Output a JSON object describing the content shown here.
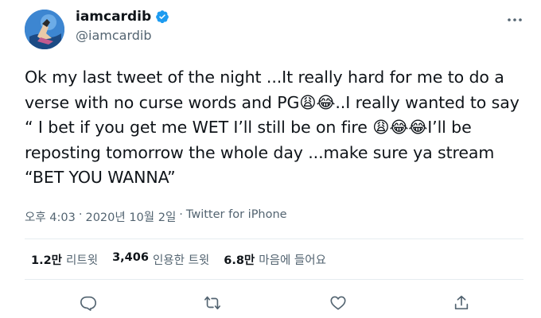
{
  "user": {
    "display_name": "iamcardib",
    "handle": "@iamcardib",
    "verified": true,
    "avatar_icon": "avatar-image"
  },
  "tweet": {
    "text": "Ok my last tweet of the night ...It really hard for me to do a verse with no curse words and PG😩😂..I really wanted to say “ I bet if you get me WET I’ll still be on fire 😩😂😂I’ll be reposting tomorrow the whole day ...make sure ya stream “BET YOU WANNA”"
  },
  "meta": {
    "time": "오후 4:03",
    "separator": "·",
    "date": "2020년 10월 2일",
    "client": "Twitter for iPhone"
  },
  "stats": {
    "retweets_count": "1.2만",
    "retweets_label": "리트윗",
    "quotes_count": "3,406",
    "quotes_label": "인용한 트윗",
    "likes_count": "6.8만",
    "likes_label": "마음에 들어요"
  },
  "icons": {
    "more": "more-icon",
    "reply": "reply-icon",
    "retweet": "retweet-icon",
    "like": "like-icon",
    "share": "share-icon",
    "verified": "verified-badge-icon"
  },
  "colors": {
    "text": "#0f1419",
    "secondary": "#536471",
    "verified": "#1d9bf0",
    "divider": "#e6ecf0"
  }
}
